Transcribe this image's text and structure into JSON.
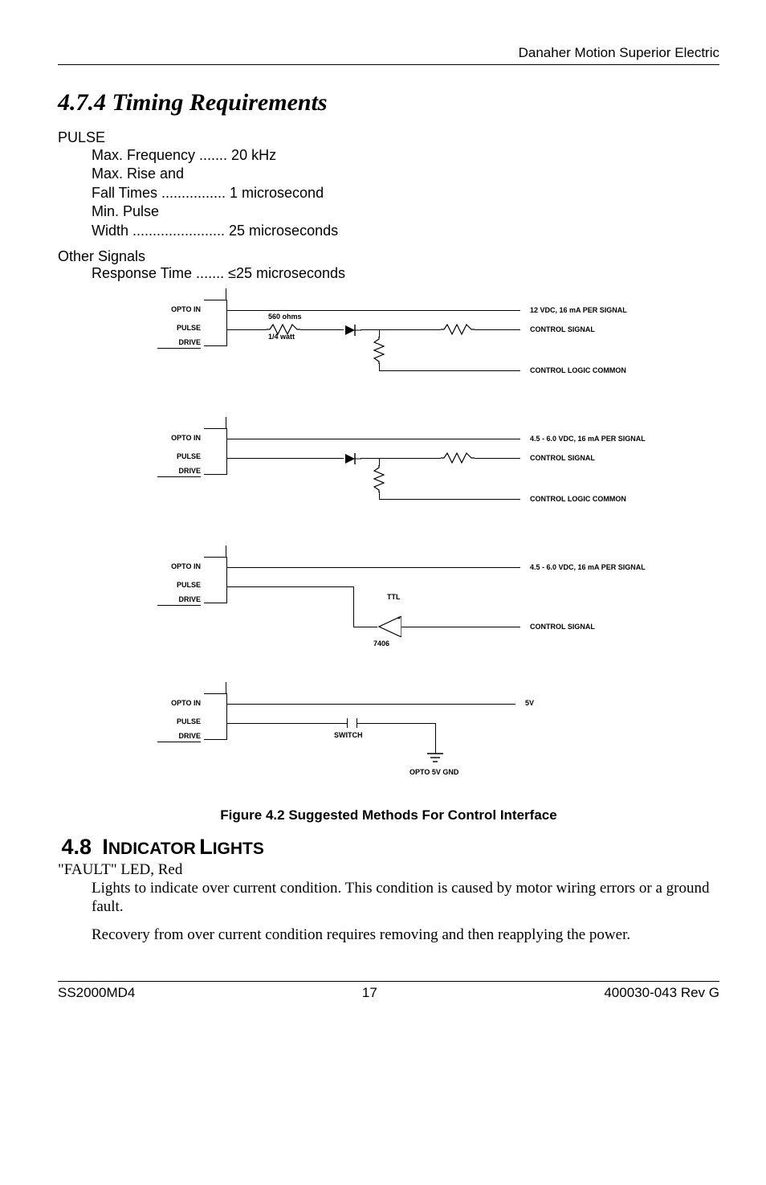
{
  "header": "Danaher Motion Superior Electric",
  "section_title": "4.7.4  Timing Requirements",
  "pulse_heading": "PULSE",
  "pulse_lines": {
    "l1": "Max. Frequency ....... 20 kHz",
    "l2": "Max. Rise and",
    "l3": "Fall Times ................ 1 microsecond",
    "l4": "Min. Pulse",
    "l5": "Width ....................... 25 microseconds"
  },
  "other_signals": "Other Signals",
  "response_prefix": "Response Time .......",
  "response_value": "25 microseconds",
  "diagram": {
    "opto_in": "OPTO IN",
    "pulse": "PULSE",
    "drive": "DRIVE",
    "res_label": "560 ohms",
    "res_watt": "1/4 watt",
    "sig_12v": "12 VDC, 16 mA PER SIGNAL",
    "ctrl_signal": "CONTROL SIGNAL",
    "ctrl_common": "CONTROL LOGIC COMMON",
    "sig_45": "4.5 - 6.0 VDC, 16 mA PER SIGNAL",
    "ttl": "TTL",
    "num7406": "7406",
    "five_v": "5V",
    "switch": "SWITCH",
    "opto_gnd": "OPTO 5V GND"
  },
  "figure_caption": "Figure 4.2 Suggested Methods For Control Interface",
  "sec48_num": "4.8",
  "sec48_I": "I",
  "sec48_ndicator": "NDICATOR",
  "sec48_L": "L",
  "sec48_ights": "IGHTS",
  "fault_led": "\"FAULT\" LED, Red",
  "para1": "Lights to indicate over current condition. This condition is caused by motor wiring errors or a ground fault.",
  "para2": "Recovery from over current condition requires removing and then reapplying the power.",
  "footer_left": "SS2000MD4",
  "footer_center": "17",
  "footer_right": "400030-043 Rev G"
}
